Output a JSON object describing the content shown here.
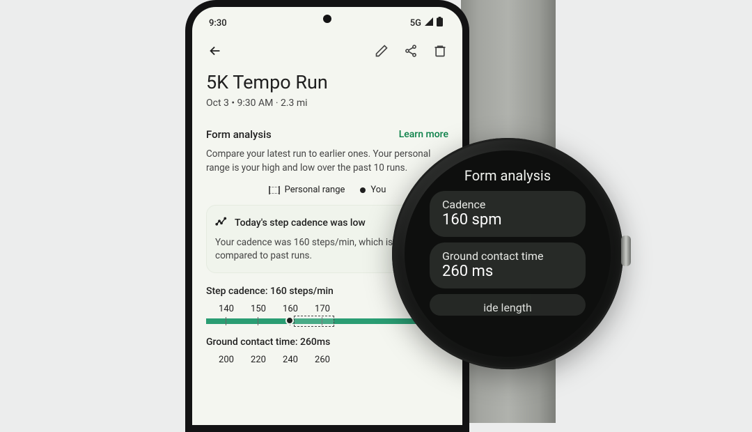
{
  "phone": {
    "status": {
      "time": "9:30",
      "network": "5G"
    },
    "title": "5K Tempo Run",
    "subtitle": "Oct 3 • 9:30 AM  · 2.3 mi",
    "form": {
      "heading": "Form analysis",
      "learn_more": "Learn more",
      "description": "Compare your latest run to earlier ones. Your personal range is your high and low over the past 10 runs.",
      "legend": {
        "range": "Personal range",
        "you": "You"
      },
      "insight": {
        "title": "Today's step cadence was low",
        "body": "Your cadence was 160 steps/min, which is low compared to past runs."
      },
      "cadence": {
        "title": "Step cadence: 160 steps/min",
        "ticks": [
          "140",
          "150",
          "160",
          "170"
        ]
      },
      "gct": {
        "title": "Ground contact time: 260ms",
        "ticks": [
          "200",
          "220",
          "240",
          "260"
        ]
      }
    }
  },
  "watch": {
    "title": "Form analysis",
    "cards": [
      {
        "label": "Cadence",
        "value": "160 spm"
      },
      {
        "label": "Ground contact time",
        "value": "260 ms"
      },
      {
        "label": "ide length",
        "value": ""
      }
    ]
  }
}
